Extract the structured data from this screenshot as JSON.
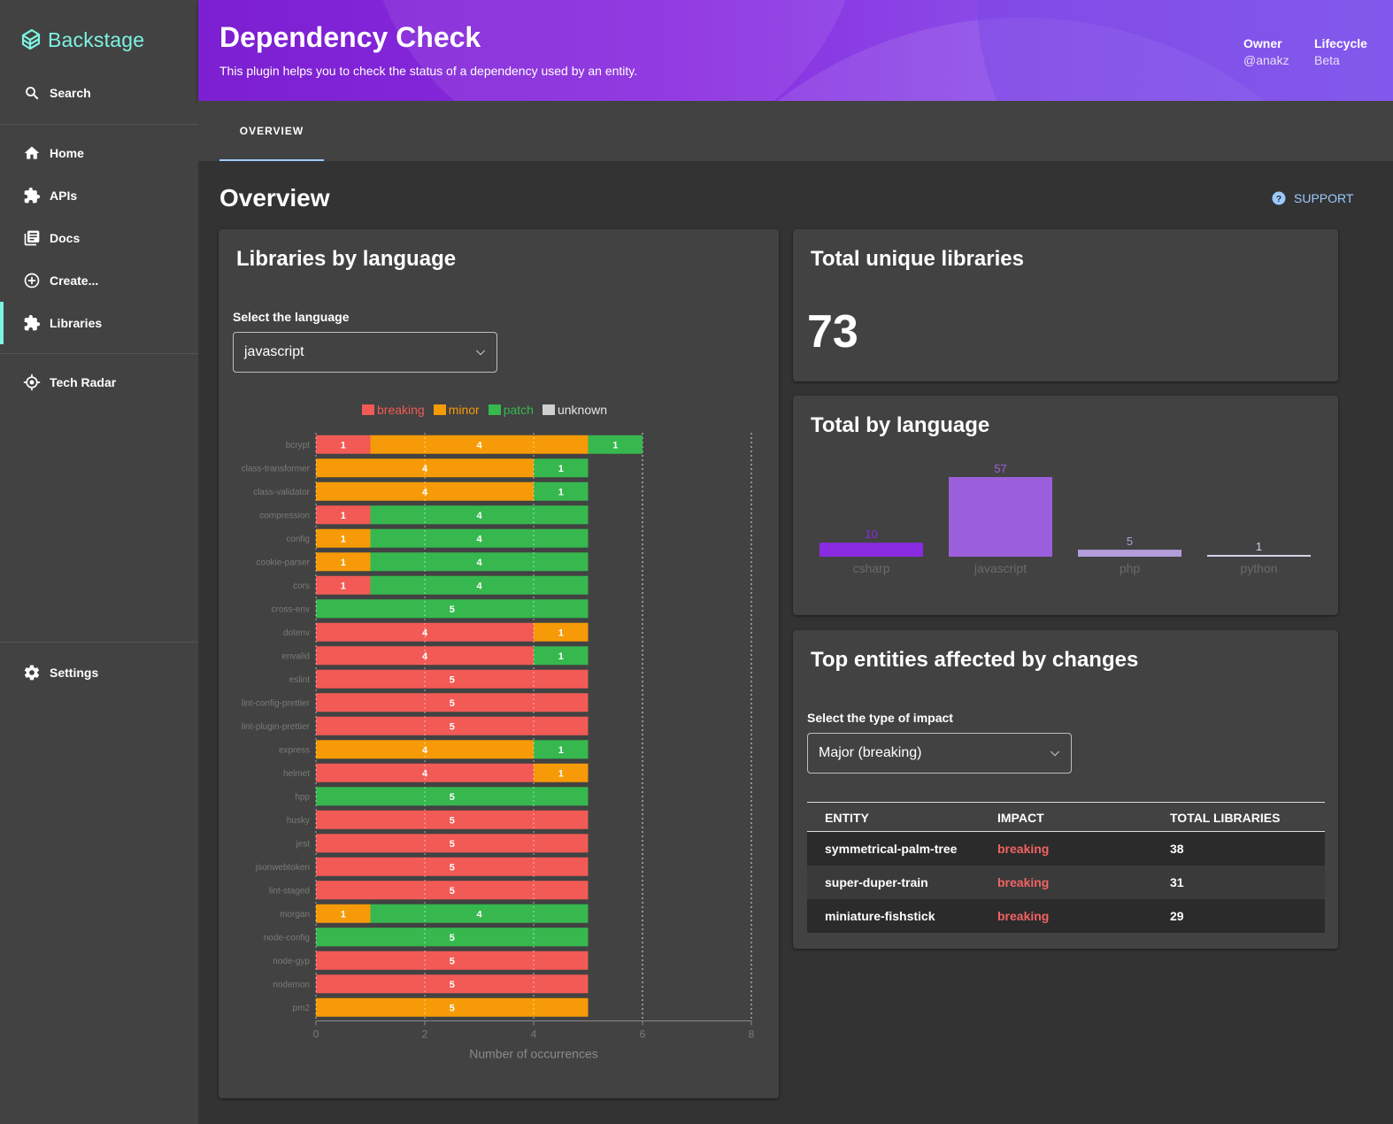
{
  "app": {
    "brand": "Backstage"
  },
  "sidebar": {
    "search": "Search",
    "items": [
      {
        "label": "Home",
        "icon": "home-icon"
      },
      {
        "label": "APIs",
        "icon": "puzzle-icon"
      },
      {
        "label": "Docs",
        "icon": "docs-icon"
      },
      {
        "label": "Create...",
        "icon": "add-circle-icon"
      },
      {
        "label": "Libraries",
        "icon": "puzzle-icon",
        "active": true
      },
      {
        "label": "Tech Radar",
        "icon": "radar-icon"
      }
    ],
    "settings": "Settings"
  },
  "header": {
    "title": "Dependency Check",
    "subtitle": "This plugin helps you to check the status of a dependency used by an entity.",
    "owner_label": "Owner",
    "owner_value": "@anakz",
    "lifecycle_label": "Lifecycle",
    "lifecycle_value": "Beta"
  },
  "tabs": [
    {
      "label": "OVERVIEW",
      "active": true
    }
  ],
  "page": {
    "title": "Overview",
    "support": "SUPPORT"
  },
  "libraries_card": {
    "title": "Libraries by language",
    "select_label": "Select the language",
    "select_value": "javascript"
  },
  "unique_card": {
    "title": "Total unique libraries",
    "value": "73"
  },
  "by_language_card": {
    "title": "Total by language"
  },
  "entities_card": {
    "title": "Top entities affected by changes",
    "select_label": "Select the type of impact",
    "select_value": "Major (breaking)",
    "columns": [
      "ENTITY",
      "IMPACT",
      "TOTAL LIBRARIES"
    ],
    "rows": [
      {
        "entity": "symmetrical-palm-tree",
        "impact": "breaking",
        "total": "38"
      },
      {
        "entity": "super-duper-train",
        "impact": "breaking",
        "total": "31"
      },
      {
        "entity": "miniature-fishstick",
        "impact": "breaking",
        "total": "29"
      }
    ]
  },
  "colors": {
    "breaking": "#f25a55",
    "minor": "#f79a07",
    "patch": "#36b84e",
    "unknown": "#cfcfcf",
    "accent": "#7df3e1",
    "link": "#9cc9ff",
    "language_bar": "#9b5fdb"
  },
  "chart_data": [
    {
      "type": "bar",
      "orientation": "horizontal",
      "stacked": true,
      "xlabel": "Number of occurrences",
      "xlim": [
        0,
        8
      ],
      "xticks": [
        0,
        2,
        4,
        6,
        8
      ],
      "legend": "top",
      "categories": [
        "bcrypt",
        "class-transformer",
        "class-validator",
        "compression",
        "config",
        "cookie-parser",
        "cors",
        "cross-env",
        "dotenv",
        "envalid",
        "eslint",
        "lint-config-prettier",
        "lint-plugin-prettier",
        "express",
        "helmet",
        "hpp",
        "husky",
        "jest",
        "jsonwebtoken",
        "lint-staged",
        "morgan",
        "node-config",
        "node-gyp",
        "nodemon",
        "pm2"
      ],
      "series": [
        {
          "name": "breaking",
          "values": [
            1,
            0,
            0,
            1,
            0,
            0,
            1,
            0,
            4,
            4,
            5,
            5,
            5,
            0,
            4,
            0,
            5,
            5,
            5,
            5,
            0,
            0,
            5,
            5,
            0
          ]
        },
        {
          "name": "minor",
          "values": [
            4,
            4,
            4,
            0,
            1,
            1,
            0,
            0,
            1,
            0,
            0,
            0,
            0,
            4,
            1,
            0,
            0,
            0,
            0,
            0,
            1,
            0,
            0,
            0,
            5
          ]
        },
        {
          "name": "patch",
          "values": [
            1,
            1,
            1,
            4,
            4,
            4,
            4,
            5,
            0,
            1,
            0,
            0,
            0,
            1,
            0,
            5,
            0,
            0,
            0,
            0,
            4,
            5,
            0,
            0,
            0
          ]
        },
        {
          "name": "unknown",
          "values": [
            0,
            0,
            0,
            0,
            0,
            0,
            0,
            0,
            0,
            0,
            0,
            0,
            0,
            0,
            0,
            0,
            0,
            0,
            0,
            0,
            0,
            0,
            0,
            0,
            0
          ]
        }
      ]
    },
    {
      "type": "bar",
      "categories": [
        "csharp",
        "javascript",
        "php",
        "python"
      ],
      "values": [
        10,
        57,
        5,
        1
      ]
    }
  ]
}
